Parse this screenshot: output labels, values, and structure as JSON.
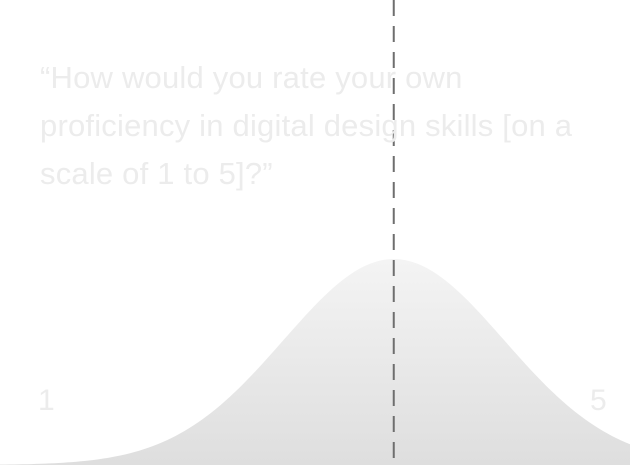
{
  "question": {
    "open_quote": "“",
    "text": "How would you rate your own proficiency in digital design skills [on a scale of 1 to 5]?",
    "close_quote": "”"
  },
  "chart_data": {
    "type": "area",
    "title": "",
    "xlabel": "",
    "ylabel": "",
    "xlim": [
      1,
      5
    ],
    "scale_labels": {
      "min": "1",
      "max": "5"
    },
    "distribution": {
      "shape": "normal",
      "mean": 3.5,
      "std_dev": 0.7,
      "peak_relative": 1.0
    },
    "marker": {
      "style": "dashed-vertical-line",
      "x": 3.5
    },
    "grid": false,
    "legend": "none",
    "colors": {
      "fill_top": "#f4f4f4",
      "fill_bottom": "#dedede",
      "marker": "#6e6e6e",
      "text": "#ececec"
    }
  }
}
